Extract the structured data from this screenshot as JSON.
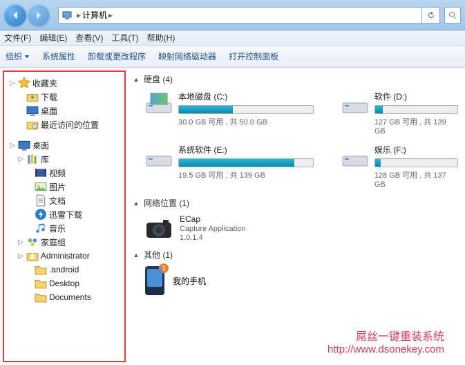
{
  "address": {
    "location": "计算机"
  },
  "menu": {
    "file": "文件(F)",
    "edit": "编辑(E)",
    "view": "查看(V)",
    "tools": "工具(T)",
    "help": "帮助(H)"
  },
  "toolbar": {
    "organize": "组织",
    "sysprops": "系统属性",
    "uninstall": "卸载或更改程序",
    "mapdrive": "映射网络驱动器",
    "ctrlpanel": "打开控制面板"
  },
  "sidebar": {
    "favorites": {
      "label": "收藏夹",
      "items": [
        {
          "label": "下载"
        },
        {
          "label": "桌面"
        },
        {
          "label": "最近访问的位置"
        }
      ]
    },
    "desktop": {
      "label": "桌面"
    },
    "libraries": {
      "label": "库",
      "items": [
        {
          "label": "视频"
        },
        {
          "label": "图片"
        },
        {
          "label": "文档"
        },
        {
          "label": "迅雷下载"
        },
        {
          "label": "音乐"
        }
      ]
    },
    "homegroup": {
      "label": "家庭组"
    },
    "user": {
      "label": "Administrator",
      "items": [
        {
          "label": ".android"
        },
        {
          "label": "Desktop"
        },
        {
          "label": "Documents"
        }
      ]
    }
  },
  "sections": {
    "disks": {
      "title": "硬盘 (4)",
      "items": [
        {
          "name": "本地磁盘 (C:)",
          "free": "30.0 GB 可用 , 共 50.0 GB",
          "fill": 40
        },
        {
          "name": "软件 (D:)",
          "free": "127 GB 可用 , 共 139 GB",
          "fill": 9
        },
        {
          "name": "系统软件 (E:)",
          "free": "19.5 GB 可用 , 共 139 GB",
          "fill": 86
        },
        {
          "name": "娱乐 (F:)",
          "free": "128 GB 可用 , 共 137 GB",
          "fill": 7
        }
      ]
    },
    "netloc": {
      "title": "网络位置 (1)",
      "item": {
        "name": "ECap",
        "sub1": "Capture Application",
        "sub2": "1.0.1.4"
      }
    },
    "other": {
      "title": "其他 (1)",
      "item": {
        "name": "我的手机",
        "badge": "3"
      }
    }
  },
  "watermark": {
    "title": "屌丝一键重装系统",
    "url": "http://www.dsonekey.com"
  }
}
